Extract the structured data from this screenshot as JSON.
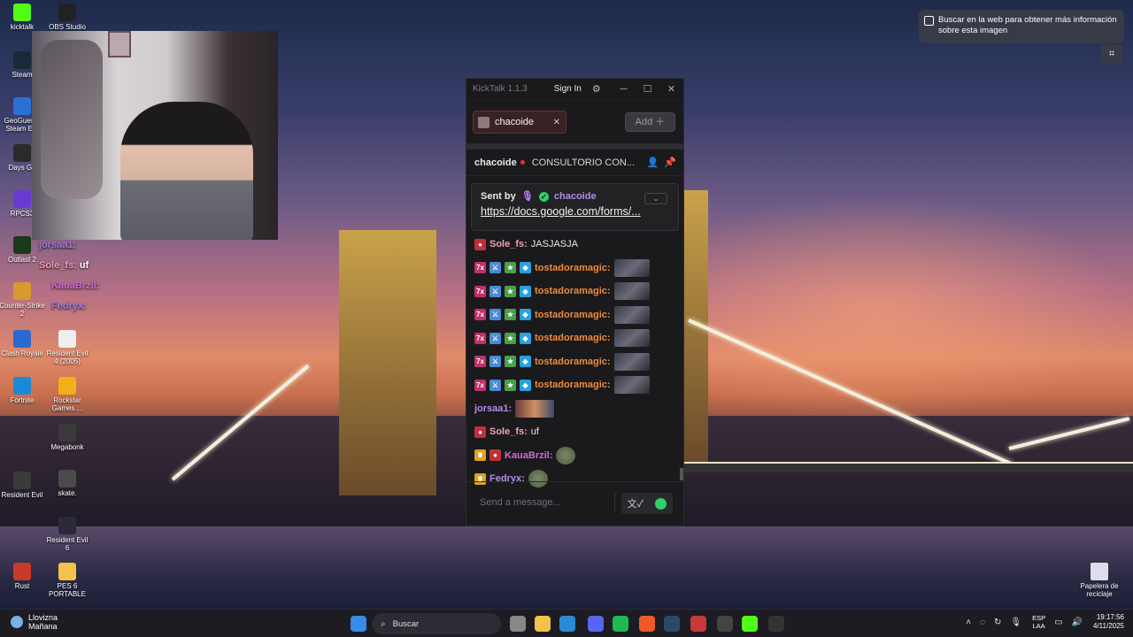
{
  "desktop": {
    "icons_left": [
      {
        "label": "kicktalk",
        "color": "#53fc18"
      },
      {
        "label": "Steam",
        "color": "#1b2838"
      },
      {
        "label": "GeoGuessr Steam E...",
        "color": "#2a6fd6"
      },
      {
        "label": "Days Go",
        "color": "#2a2a2a"
      },
      {
        "label": "RPCS3",
        "color": "#6a3ad0"
      },
      {
        "label": "Outlast 2",
        "color": "#1a3a1a"
      },
      {
        "label": "Counter-Strike 2",
        "color": "#d89a2a"
      },
      {
        "label": "Clash Royale",
        "color": "#2a6ad0"
      },
      {
        "label": "Fortnite",
        "color": "#1a8ad6"
      },
      {
        "label": "Resident Evil",
        "color": "#3a3a3a"
      },
      {
        "label": "Rust",
        "color": "#c83a2a"
      }
    ],
    "icons_right": [
      {
        "label": "OBS Studio",
        "color": "#222"
      },
      {
        "label": "Resident Evil 4 (2005)",
        "color": "#eeeeee"
      },
      {
        "label": "Rockstar Games ...",
        "color": "#f2b01a"
      },
      {
        "label": "Megabonk",
        "color": "#3a3a3a"
      },
      {
        "label": "skate.",
        "color": "#4a4a4a"
      },
      {
        "label": "Resident Evil 6",
        "color": "#2a2a3a"
      },
      {
        "label": "PES 6 PORTABLE",
        "color": "#f2c24a"
      }
    ],
    "recycle_bin": "Papelera de reciclaje",
    "overlay_chat": [
      {
        "user": "jorsaa1:",
        "text": ""
      },
      {
        "user": "Sole_fs:",
        "text": "uf"
      },
      {
        "user": "KauaBrzil:",
        "text": ""
      },
      {
        "user": "Fedryx:",
        "text": ""
      }
    ]
  },
  "image_search_popup": {
    "text": "Buscar en la web para obtener más información sobre esta imagen",
    "lens_icon": "⌗"
  },
  "kicktalk": {
    "title": "KickTalk 1.1.3",
    "sign_in": "Sign In",
    "settings_icon": "⚙",
    "window_controls": [
      "─",
      "☐",
      "✕"
    ],
    "tab": {
      "label": "chacoide",
      "close": "✕"
    },
    "add_button": "Add ＋",
    "channel": {
      "name": "chacoide",
      "topic": "CONSULTORIO CON...",
      "user_icon": "👤",
      "pin_icon": "📌"
    },
    "pinned": {
      "sent_by_label": "Sent by",
      "sender": "chacoide",
      "link": "https://docs.google.com/forms/...",
      "chevron": "⌄"
    },
    "messages": [
      {
        "badges": [
          {
            "color": "#c0303a",
            "glyph": "●"
          }
        ],
        "user": "Sole_fs:",
        "user_color": "#f0a0b0",
        "text": "JASJASJA",
        "emote": ""
      },
      {
        "badges": [
          {
            "color": "#c0306a",
            "glyph": "7x"
          },
          {
            "color": "#4a8ad6",
            "glyph": "⚔"
          },
          {
            "color": "#4aa04a",
            "glyph": "★"
          },
          {
            "color": "#2aa0e0",
            "glyph": "◆"
          }
        ],
        "user": "tostadoramagic:",
        "user_color": "#f08a3a",
        "text": "",
        "emote": "emote"
      },
      {
        "badges": [
          {
            "color": "#c0306a",
            "glyph": "7x"
          },
          {
            "color": "#4a8ad6",
            "glyph": "⚔"
          },
          {
            "color": "#4aa04a",
            "glyph": "★"
          },
          {
            "color": "#2aa0e0",
            "glyph": "◆"
          }
        ],
        "user": "tostadoramagic:",
        "user_color": "#f08a3a",
        "text": "",
        "emote": "emote"
      },
      {
        "badges": [
          {
            "color": "#c0306a",
            "glyph": "7x"
          },
          {
            "color": "#4a8ad6",
            "glyph": "⚔"
          },
          {
            "color": "#4aa04a",
            "glyph": "★"
          },
          {
            "color": "#2aa0e0",
            "glyph": "◆"
          }
        ],
        "user": "tostadoramagic:",
        "user_color": "#f08a3a",
        "text": "",
        "emote": "emote"
      },
      {
        "badges": [
          {
            "color": "#c0306a",
            "glyph": "7x"
          },
          {
            "color": "#4a8ad6",
            "glyph": "⚔"
          },
          {
            "color": "#4aa04a",
            "glyph": "★"
          },
          {
            "color": "#2aa0e0",
            "glyph": "◆"
          }
        ],
        "user": "tostadoramagic:",
        "user_color": "#f08a3a",
        "text": "",
        "emote": "emote"
      },
      {
        "badges": [
          {
            "color": "#c0306a",
            "glyph": "7x"
          },
          {
            "color": "#4a8ad6",
            "glyph": "⚔"
          },
          {
            "color": "#4aa04a",
            "glyph": "★"
          },
          {
            "color": "#2aa0e0",
            "glyph": "◆"
          }
        ],
        "user": "tostadoramagic:",
        "user_color": "#f08a3a",
        "text": "",
        "emote": "emote"
      },
      {
        "badges": [
          {
            "color": "#c0306a",
            "glyph": "7x"
          },
          {
            "color": "#4a8ad6",
            "glyph": "⚔"
          },
          {
            "color": "#4aa04a",
            "glyph": "★"
          },
          {
            "color": "#2aa0e0",
            "glyph": "◆"
          }
        ],
        "user": "tostadoramagic:",
        "user_color": "#f08a3a",
        "text": "",
        "emote": "emote"
      },
      {
        "badges": [],
        "user": "jorsaa1:",
        "user_color": "#b48be8",
        "text": "",
        "emote": "wide"
      },
      {
        "badges": [
          {
            "color": "#c0303a",
            "glyph": "●"
          }
        ],
        "user": "Sole_fs:",
        "user_color": "#f0a0b0",
        "text": "uf",
        "emote": ""
      },
      {
        "badges": [
          {
            "color": "#e0a020",
            "glyph": "♛"
          },
          {
            "color": "#c0303a",
            "glyph": "●"
          }
        ],
        "user": "KauaBrzil:",
        "user_color": "#d06ad8",
        "text": "",
        "emote": "small"
      },
      {
        "badges": [
          {
            "color": "#e0a020",
            "glyph": "♛"
          }
        ],
        "user": "Fedryx:",
        "user_color": "#b48be8",
        "text": "",
        "emote": "small"
      }
    ],
    "input_placeholder": "Send a message...",
    "input_buttons": {
      "translate": "文✓"
    }
  },
  "taskbar": {
    "weather": {
      "condition": "Llovizna",
      "when": "Mañana"
    },
    "search_placeholder": "Buscar",
    "apps": [
      {
        "name": "windows-start",
        "color": "#3a8ae8"
      },
      {
        "name": "task-view",
        "color": "#888888"
      },
      {
        "name": "file-explorer",
        "color": "#f2c24a"
      },
      {
        "name": "bing",
        "color": "#2a8ad6"
      },
      {
        "name": "discord",
        "color": "#5865f2"
      },
      {
        "name": "spotify",
        "color": "#1db954"
      },
      {
        "name": "brave",
        "color": "#f05a28"
      },
      {
        "name": "steam",
        "color": "#2a4a6a"
      },
      {
        "name": "voicemeeter",
        "color": "#c83a3a"
      },
      {
        "name": "obs",
        "color": "#444444"
      },
      {
        "name": "kicktalk",
        "color": "#53fc18"
      },
      {
        "name": "epic-games",
        "color": "#333333"
      }
    ],
    "tray": {
      "lang1": "ESP",
      "lang2": "LAA",
      "time": "19:17:56",
      "date": "4/11/2025"
    }
  }
}
